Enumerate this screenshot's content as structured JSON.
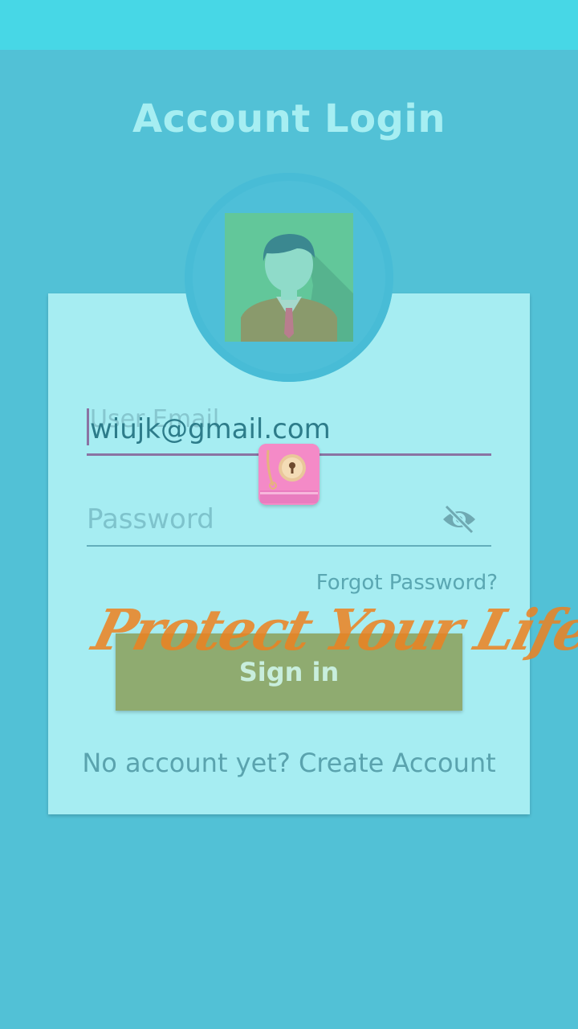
{
  "header": {
    "title": "Account Login"
  },
  "form": {
    "email_label": "User Email",
    "email_value": "wiujk@gmail.com",
    "password_placeholder": "Password",
    "forgot_password": "Forgot Password?",
    "sign_in": "Sign in",
    "no_account_text": "No account yet? Create Account"
  },
  "overlay": {
    "watermark_text": "Protect Your Life",
    "watermark_suffix": "!!!"
  },
  "icons": {
    "avatar": "user-avatar-icon",
    "visibility": "eye-off-icon",
    "app": "lock-safe-app-icon"
  },
  "colors": {
    "background": "#52c1d6",
    "status_bar": "#47d7e6",
    "card": "#a6edf2",
    "button": "#8fab70",
    "watermark": "#ed801e",
    "focused_underline": "#8a73a3"
  }
}
